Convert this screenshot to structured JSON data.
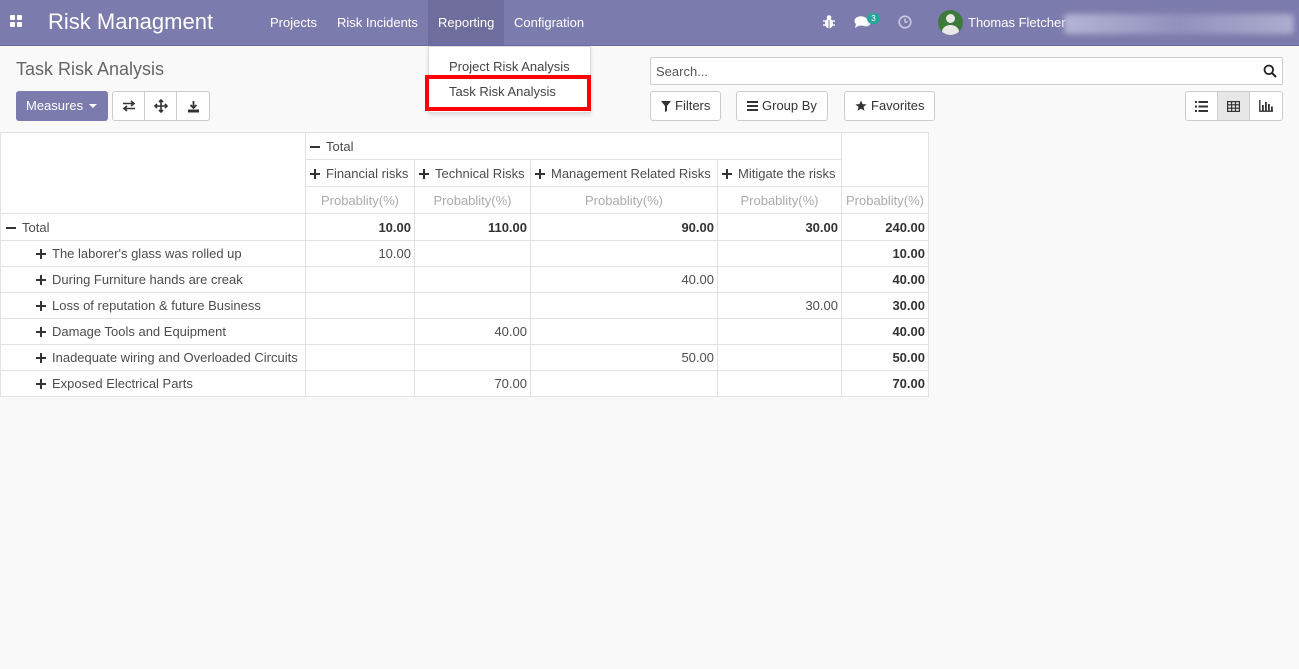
{
  "navbar": {
    "app_title": "Risk Managment",
    "menu": [
      "Projects",
      "Risk Incidents",
      "Reporting",
      "Configration"
    ],
    "active_menu": "Reporting",
    "messages_badge": "3",
    "user_name": "Thomas Fletcher",
    "bg_color": "#7c7bad"
  },
  "reporting_dropdown": {
    "items": [
      "Project Risk Analysis",
      "Task Risk Analysis"
    ],
    "highlighted": "Task Risk Analysis",
    "highlight_color": "#ff0000"
  },
  "control_panel": {
    "title": "Task Risk Analysis",
    "measures_label": "Measures",
    "search_placeholder": "Search...",
    "filters_label": "Filters",
    "group_by_label": "Group By",
    "favorites_label": "Favorites",
    "icons": [
      "flip-axis-icon",
      "expand-all-icon",
      "download-icon"
    ],
    "views": [
      "list-view-icon",
      "pivot-view-icon",
      "graph-view-icon"
    ],
    "active_view": "pivot-view-icon"
  },
  "pivot": {
    "col_total_label": "Total",
    "columns": [
      "Financial risks",
      "Technical Risks",
      "Management Related Risks",
      "Mitigate the risks"
    ],
    "measure_label": "Probablity(%)",
    "row_total_label": "Total",
    "totals": [
      "10.00",
      "110.00",
      "90.00",
      "30.00",
      "240.00"
    ],
    "rows": [
      {
        "label": "The laborer's glass was rolled up",
        "cells": [
          "10.00",
          "",
          "",
          ""
        ],
        "total": "10.00"
      },
      {
        "label": "During Furniture hands are creak",
        "cells": [
          "",
          "",
          "40.00",
          ""
        ],
        "total": "40.00"
      },
      {
        "label": "Loss of reputation & future Business",
        "cells": [
          "",
          "",
          "",
          "30.00"
        ],
        "total": "30.00"
      },
      {
        "label": "Damage Tools and Equipment",
        "cells": [
          "",
          "40.00",
          "",
          ""
        ],
        "total": "40.00"
      },
      {
        "label": "Inadequate wiring and Overloaded Circuits",
        "cells": [
          "",
          "",
          "50.00",
          ""
        ],
        "total": "50.00"
      },
      {
        "label": "Exposed Electrical Parts",
        "cells": [
          "",
          "70.00",
          "",
          ""
        ],
        "total": "70.00"
      }
    ]
  }
}
